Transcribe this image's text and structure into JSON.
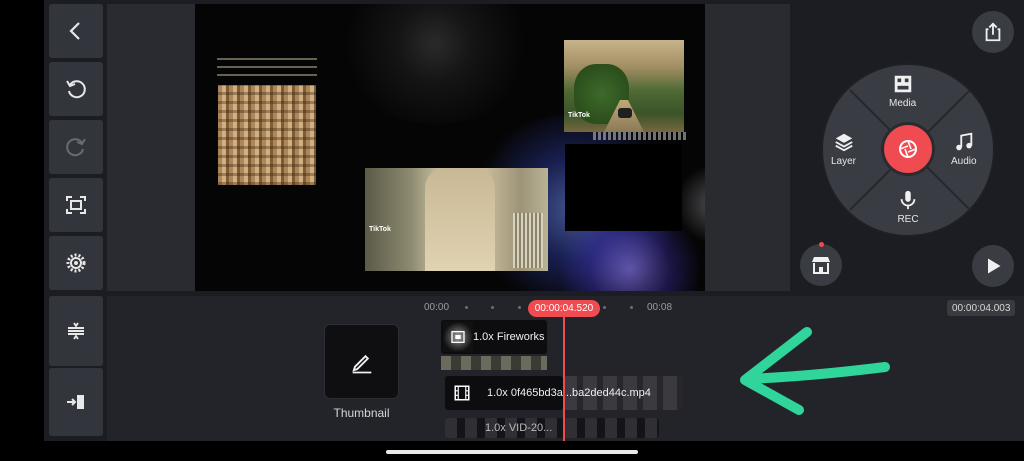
{
  "toolbar": {
    "back": "back-arrow",
    "undo": "undo",
    "redo": "redo",
    "fullscreen": "fullscreen",
    "settings": "settings",
    "split": "split-layers",
    "export_start": "go-to-start"
  },
  "preview": {
    "tiktok_label_1": "TikTok",
    "tiktok_label_2": "TikTok",
    "tiktok_label_3": "TikTok"
  },
  "wheel": {
    "media": "Media",
    "layer": "Layer",
    "audio": "Audio",
    "rec": "REC"
  },
  "timeline": {
    "start_time": "00:00",
    "end_mark": "00:08",
    "playhead_time": "00:00:04.520",
    "total_time": "00:00:04.003",
    "thumbnail_label": "Thumbnail",
    "tracks": [
      {
        "label": "1.0x Fireworks f"
      },
      {
        "label": "1.0x 0f465bd3a...ba2ded44c.mp4"
      },
      {
        "label": "1.0x VID-20..."
      }
    ]
  },
  "colors": {
    "accent": "#f04b50",
    "annotation_arrow": "#2fd59a"
  }
}
